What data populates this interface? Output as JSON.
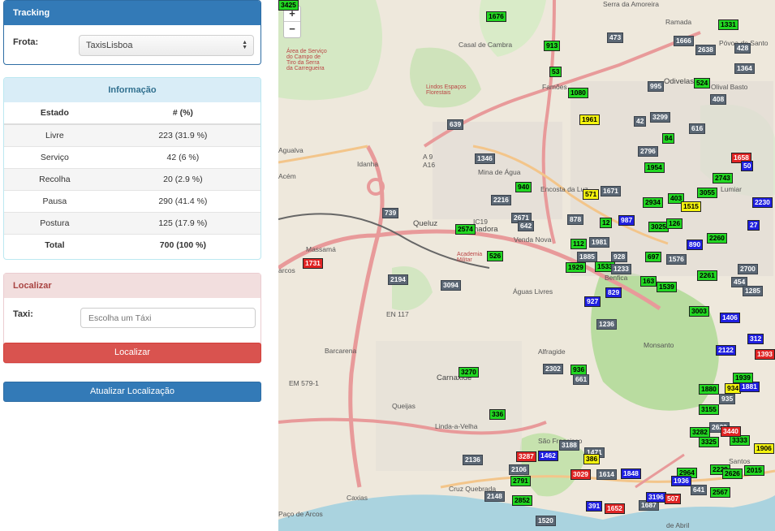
{
  "tracking": {
    "title": "Tracking",
    "frota_label": "Frota:",
    "frota_value": "TaxisLisboa"
  },
  "info": {
    "title": "Informação",
    "headers": [
      "Estado",
      "# (%)"
    ],
    "rows": [
      [
        "Livre",
        "223 (31.9 %)"
      ],
      [
        "Serviço",
        "42 (6 %)"
      ],
      [
        "Recolha",
        "20 (2.9 %)"
      ],
      [
        "Pausa",
        "290 (41.4 %)"
      ],
      [
        "Postura",
        "125 (17.9 %)"
      ]
    ],
    "total": [
      "Total",
      "700 (100 %)"
    ]
  },
  "localizar": {
    "title": "Localizar",
    "taxi_label": "Taxi:",
    "placeholder": "Escolha um Táxi",
    "button": "Localizar"
  },
  "update_button": "Atualizar Localização",
  "map": {
    "zoom_in": "+",
    "zoom_out": "−",
    "places": [
      [
        "Serra da Amoreira",
        "place"
      ],
      [
        "Ramada",
        "place"
      ],
      [
        "Póvoa de Santo",
        "place"
      ],
      [
        "Casal de Cambra",
        "place"
      ],
      [
        "Famões",
        "place"
      ],
      [
        "Odivelas",
        "place big"
      ],
      [
        "Olival Basto",
        "place"
      ],
      [
        "Idanha",
        "place"
      ],
      [
        "Mina de Água",
        "place"
      ],
      [
        "Encosta da Luz",
        "place"
      ],
      [
        "Queluz",
        "place big"
      ],
      [
        "Amadora",
        "place big"
      ],
      [
        "Venda Nova",
        "place"
      ],
      [
        "Massamá",
        "place"
      ],
      [
        "Benfica",
        "place"
      ],
      [
        "Águas Livres",
        "place"
      ],
      [
        "Alfragide",
        "place"
      ],
      [
        "Barcarena",
        "place"
      ],
      [
        "Carnaxide",
        "place big"
      ],
      [
        "Queijas",
        "place"
      ],
      [
        "Linda-a-Velha",
        "place"
      ],
      [
        "Cruz Quebrada",
        "place"
      ],
      [
        "Caxias",
        "place"
      ],
      [
        "Paço de Arcos",
        "place"
      ],
      [
        "São Francisco",
        "place"
      ],
      [
        "Santos",
        "place"
      ],
      [
        "Agualva",
        "place"
      ],
      [
        "Lumiar",
        "place"
      ],
      [
        "de Abril",
        "place"
      ],
      [
        "Academia Militar",
        "place red"
      ],
      [
        "Área de Serviço do Campo de Tiro da Serra da Carregueira",
        "place red"
      ],
      [
        "Lindos Espaços Florestais",
        "place red"
      ],
      [
        "Monsanto",
        "place"
      ],
      [
        "A 9",
        "place"
      ],
      [
        "A16",
        "place"
      ],
      [
        "EN 117",
        "place"
      ],
      [
        "EM 579-1",
        "place"
      ],
      [
        "IC19",
        "place"
      ],
      [
        "Acém",
        "place"
      ],
      [
        "arcos",
        "place"
      ]
    ],
    "markers": [
      [
        "1676",
        "livre"
      ],
      [
        "913",
        "livre"
      ],
      [
        "53",
        "livre"
      ],
      [
        "1080",
        "livre"
      ],
      [
        "473",
        "pausa"
      ],
      [
        "1666",
        "pausa"
      ],
      [
        "1331",
        "livre"
      ],
      [
        "2638",
        "pausa"
      ],
      [
        "428",
        "pausa"
      ],
      [
        "1364",
        "pausa"
      ],
      [
        "995",
        "pausa"
      ],
      [
        "524",
        "livre"
      ],
      [
        "408",
        "pausa"
      ],
      [
        "1961",
        "postura"
      ],
      [
        "42",
        "pausa"
      ],
      [
        "3299",
        "pausa"
      ],
      [
        "616",
        "pausa"
      ],
      [
        "639",
        "pausa"
      ],
      [
        "84",
        "livre"
      ],
      [
        "2796",
        "pausa"
      ],
      [
        "1346",
        "pausa"
      ],
      [
        "1954",
        "livre"
      ],
      [
        "1658",
        "recolha"
      ],
      [
        "50",
        "servico"
      ],
      [
        "940",
        "livre"
      ],
      [
        "2743",
        "livre"
      ],
      [
        "1671",
        "pausa"
      ],
      [
        "571",
        "postura"
      ],
      [
        "2216",
        "pausa"
      ],
      [
        "3055",
        "livre"
      ],
      [
        "2934",
        "livre"
      ],
      [
        "403",
        "livre"
      ],
      [
        "1515",
        "postura"
      ],
      [
        "2230",
        "servico"
      ],
      [
        "739",
        "pausa"
      ],
      [
        "2671",
        "pausa"
      ],
      [
        "642",
        "pausa"
      ],
      [
        "878",
        "pausa"
      ],
      [
        "12",
        "livre"
      ],
      [
        "987",
        "servico"
      ],
      [
        "3025",
        "livre"
      ],
      [
        "126",
        "livre"
      ],
      [
        "27",
        "servico"
      ],
      [
        "2574",
        "livre"
      ],
      [
        "2260",
        "livre"
      ],
      [
        "112",
        "livre"
      ],
      [
        "1981",
        "pausa"
      ],
      [
        "890",
        "servico"
      ],
      [
        "1731",
        "recolha"
      ],
      [
        "526",
        "livre"
      ],
      [
        "1885",
        "pausa"
      ],
      [
        "928",
        "pausa"
      ],
      [
        "697",
        "livre"
      ],
      [
        "1576",
        "pausa"
      ],
      [
        "1929",
        "livre"
      ],
      [
        "1533",
        "livre"
      ],
      [
        "1233",
        "pausa"
      ],
      [
        "2700",
        "pausa"
      ],
      [
        "2194",
        "pausa"
      ],
      [
        "3094",
        "pausa"
      ],
      [
        "163",
        "livre"
      ],
      [
        "1539",
        "livre"
      ],
      [
        "2261",
        "livre"
      ],
      [
        "454",
        "pausa"
      ],
      [
        "1285",
        "pausa"
      ],
      [
        "829",
        "servico"
      ],
      [
        "927",
        "servico"
      ],
      [
        "3003",
        "livre"
      ],
      [
        "1406",
        "servico"
      ],
      [
        "2122",
        "servico"
      ],
      [
        "312",
        "servico"
      ],
      [
        "1236",
        "pausa"
      ],
      [
        "1393",
        "recolha"
      ],
      [
        "2302",
        "pausa"
      ],
      [
        "936",
        "livre"
      ],
      [
        "661",
        "pausa"
      ],
      [
        "3270",
        "livre"
      ],
      [
        "1880",
        "livre"
      ],
      [
        "934",
        "postura"
      ],
      [
        "1881",
        "servico"
      ],
      [
        "935",
        "pausa"
      ],
      [
        "3155",
        "livre"
      ],
      [
        "336",
        "livre"
      ],
      [
        "2622",
        "pausa"
      ],
      [
        "3282",
        "livre"
      ],
      [
        "3325",
        "livre"
      ],
      [
        "3333",
        "livre"
      ],
      [
        "1906",
        "postura"
      ],
      [
        "3287",
        "recolha"
      ],
      [
        "1462",
        "servico"
      ],
      [
        "3188",
        "pausa"
      ],
      [
        "1471",
        "pausa"
      ],
      [
        "386",
        "postura"
      ],
      [
        "2136",
        "pausa"
      ],
      [
        "2106",
        "pausa"
      ],
      [
        "2791",
        "livre"
      ],
      [
        "3029",
        "recolha"
      ],
      [
        "1614",
        "pausa"
      ],
      [
        "1848",
        "servico"
      ],
      [
        "2964",
        "livre"
      ],
      [
        "2229",
        "livre"
      ],
      [
        "2626",
        "livre"
      ],
      [
        "2015",
        "livre"
      ],
      [
        "1936",
        "servico"
      ],
      [
        "2148",
        "pausa"
      ],
      [
        "2852",
        "livre"
      ],
      [
        "641",
        "pausa"
      ],
      [
        "1520",
        "pausa"
      ],
      [
        "391",
        "servico"
      ],
      [
        "1652",
        "recolha"
      ],
      [
        "1687",
        "pausa"
      ],
      [
        "3196",
        "servico"
      ],
      [
        "507",
        "recolha"
      ],
      [
        "3440",
        "recolha"
      ],
      [
        "2567",
        "livre"
      ],
      [
        "1939",
        "livre"
      ],
      [
        "3425",
        "livre"
      ]
    ]
  }
}
